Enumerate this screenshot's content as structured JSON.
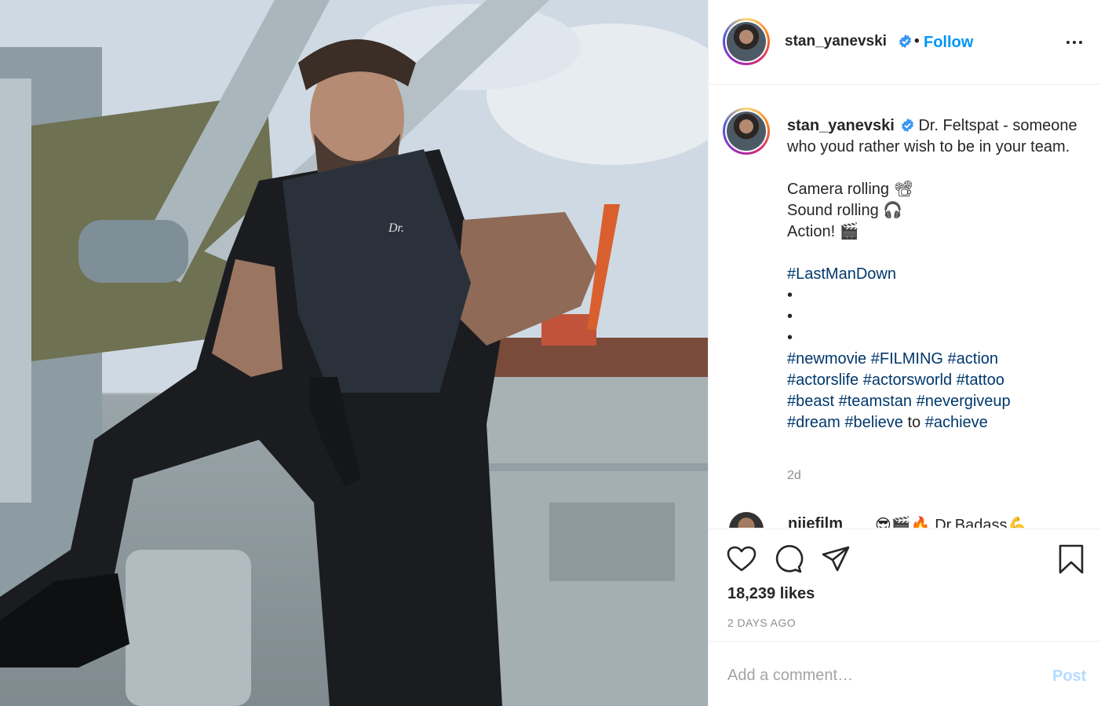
{
  "photo": {
    "alt": ""
  },
  "header": {
    "username": "stan_yanevski",
    "separator": "•",
    "follow_label": "Follow"
  },
  "caption": {
    "username": "stan_yanevski",
    "line1": "Dr. Feltspat - someone who youd rather wish to be in your team.",
    "line2": "Camera rolling 📽",
    "line3": "Sound rolling 🎧",
    "line4": "Action! 🎬",
    "hashtag_main": "#LastManDown",
    "bullet": "•",
    "tags_row1": [
      "#newmovie",
      "#FILMING",
      "#action"
    ],
    "tags_row2": [
      "#actorslife",
      "#actorsworld",
      "#tattoo"
    ],
    "tags_row3": [
      "#beast",
      "#teamstan",
      "#nevergiveup"
    ],
    "tags_row4": [
      "#dream",
      "#believe",
      "to",
      "#achieve"
    ],
    "time_ago": "2d"
  },
  "next_comment": {
    "username": "njiefilm",
    "text": "😎🎬🔥 Dr.Badass💪"
  },
  "actions": {
    "likes": "18,239 likes",
    "posted": "2 DAYS AGO"
  },
  "comment_box": {
    "placeholder": "Add a comment…",
    "post_label": "Post"
  },
  "colors": {
    "accent": "#0095f6",
    "hashtag": "#00376b",
    "muted": "#8e8e8e",
    "post_disabled": "#b3dbff",
    "verified": "#3897f0"
  },
  "icons": [
    "like-icon",
    "comment-icon",
    "share-icon",
    "save-icon",
    "verified-icon",
    "more-icon"
  ]
}
